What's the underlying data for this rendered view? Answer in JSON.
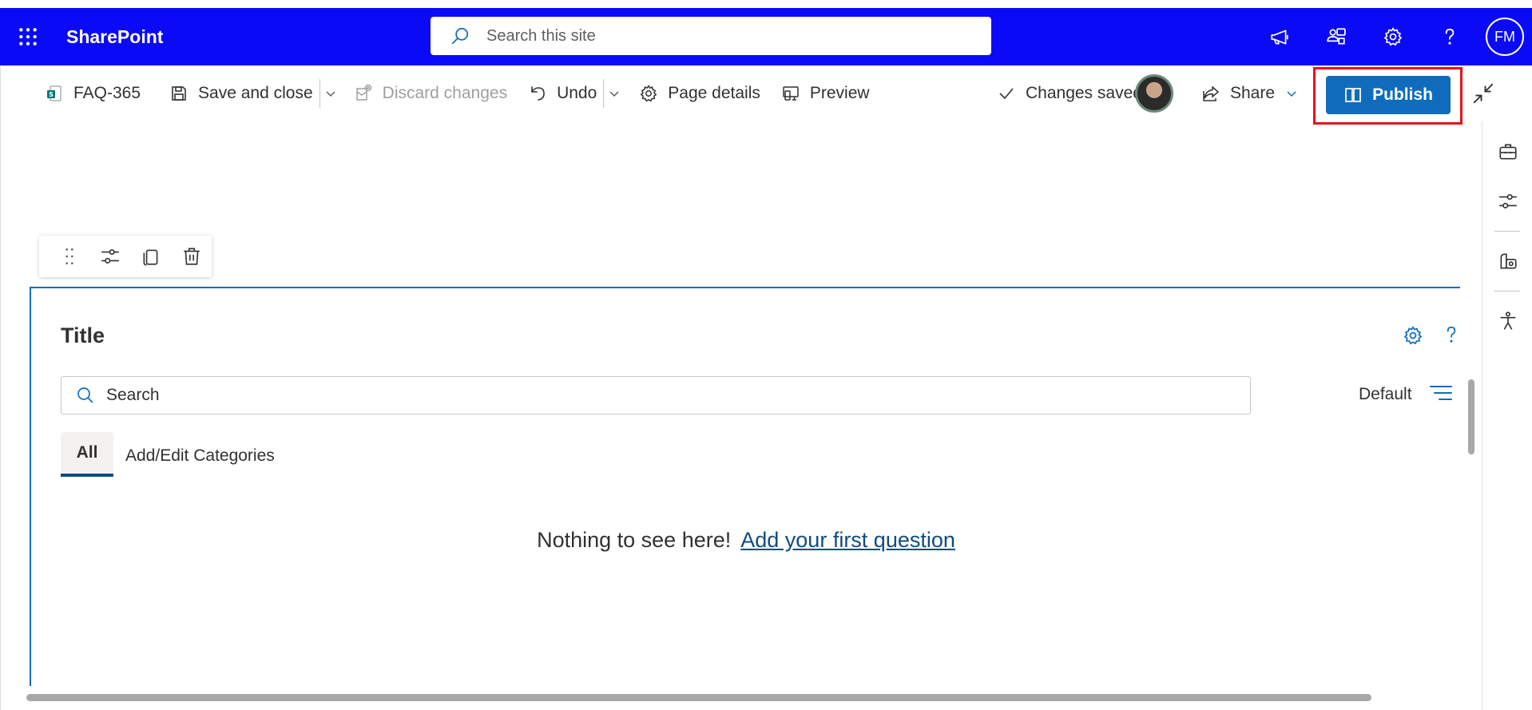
{
  "suitebar": {
    "brand": "SharePoint",
    "search_placeholder": "Search this site",
    "avatar_initials": "FM",
    "icons": [
      "waffle-icon",
      "megaphone-icon",
      "teams-share-icon",
      "gear-icon",
      "help-icon"
    ]
  },
  "commandbar": {
    "page_name": "FAQ-365",
    "save_close": "Save and close",
    "discard": "Discard changes",
    "undo": "Undo",
    "page_details": "Page details",
    "preview": "Preview",
    "status": "Changes saved",
    "share": "Share",
    "publish": "Publish"
  },
  "webpart": {
    "title": "Title",
    "search_placeholder": "Search",
    "sort_label": "Default",
    "tabs": [
      "All",
      "Add/Edit Categories"
    ],
    "empty_text": "Nothing to see here!",
    "empty_link": "Add your first question"
  },
  "colors": {
    "suitebar_bg": "#0a0af6",
    "accent": "#0f6cbd",
    "highlight_box": "#e8101c"
  }
}
